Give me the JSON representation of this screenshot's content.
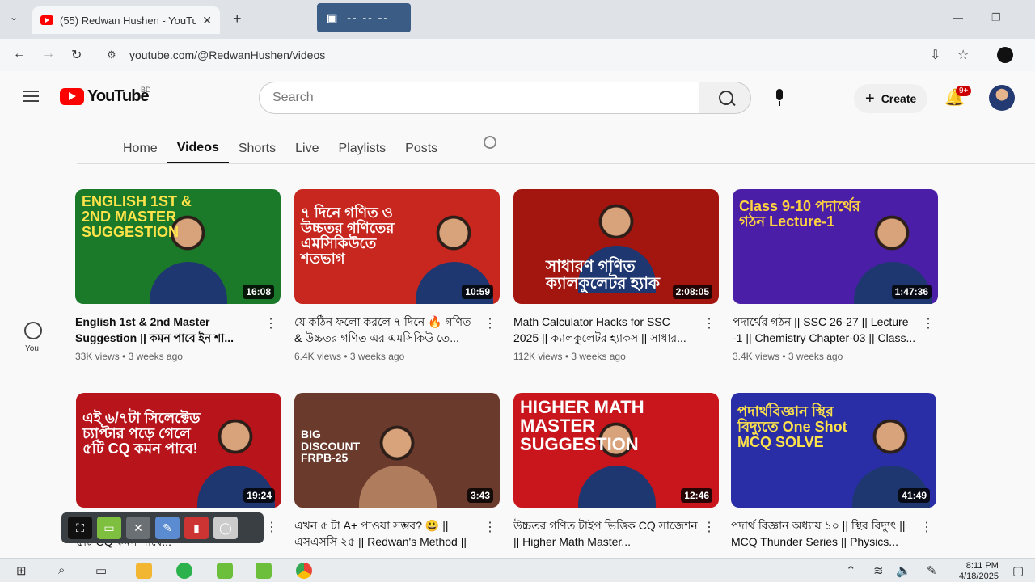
{
  "browser": {
    "tab_title": "(55) Redwan Hushen - YouTube",
    "tab_close": "✕",
    "new_tab": "+",
    "tablist": "⌄",
    "recorder_label": "-- -- --",
    "url": "youtube.com/@RedwanHushen/videos",
    "window_controls": {
      "minimize": "—",
      "restore": "❐"
    }
  },
  "header": {
    "logo_text": "YouTube",
    "country_code": "BD",
    "search_placeholder": "Search",
    "create_label": "Create",
    "notification_badge": "9+"
  },
  "channel_tabs": [
    {
      "label": "Home"
    },
    {
      "label": "Videos",
      "active": true
    },
    {
      "label": "Shorts"
    },
    {
      "label": "Live"
    },
    {
      "label": "Playlists"
    },
    {
      "label": "Posts"
    }
  ],
  "sidebar": {
    "you_label": "You"
  },
  "videos": [
    {
      "title": "English 1st & 2nd Master Suggestion || কমন পাবে ইন শা...",
      "views": "33K views",
      "age": "3 weeks ago",
      "duration": "16:08",
      "thumb_text": "ENGLISH 1ST & 2ND MASTER SUGGESTION",
      "bg": "#1b7a2a"
    },
    {
      "title": "যে কঠিন ফলো করলে ৭ দিনে 🔥 গণিত & উচ্চতর গণিত এর এমসিকিউ তে...",
      "views": "6.4K views",
      "age": "3 weeks ago",
      "duration": "10:59",
      "thumb_text": "৭ দিনে গণিত ও উচ্চতর গণিতের এমসিকিউতে শতভাগ",
      "bg": "#c7271f"
    },
    {
      "title": "Math Calculator Hacks for SSC 2025 || ক্যালকুলেটর হ্যাকস || সাধার...",
      "views": "112K views",
      "age": "3 weeks ago",
      "duration": "2:08:05",
      "thumb_text": "সাধারণ গণিত ক্যালকুলেটর হ্যাক",
      "bg": "#a3150f"
    },
    {
      "title": "পদার্থের গঠন || SSC 26-27 || Lecture -1 || Chemistry Chapter-03 || Class...",
      "views": "3.4K views",
      "age": "3 weeks ago",
      "duration": "1:47:36",
      "thumb_text": "Class 9-10 পদার্থের গঠন Lecture-1",
      "bg": "#4b1ea8"
    },
    {
      "title": "এই ৬/৭টা সিলেক্টেড চ্যাপ্টার পড়ে গেলে ৫টি CQ কমন পাবে...",
      "views": "",
      "age": "",
      "duration": "19:24",
      "thumb_text": "এই ৬/৭টা সিলেক্টেড চ্যাপ্টার পড়ে গেলে ৫টি CQ কমন পাবে!",
      "bg": "#b8141b"
    },
    {
      "title": "এখন ৫ টা A+ পাওয়া সম্ভব? 😃 || এসএসসি ২৫ || Redwan's Method ||",
      "views": "",
      "age": "",
      "duration": "3:43",
      "thumb_text": "BIG DISCOUNT FRPB-25",
      "bg": "#6a3a2c"
    },
    {
      "title": "উচ্চতর গণিত টাইপ ভিত্তিক CQ সাজেশন || Higher Math Master...",
      "views": "",
      "age": "",
      "duration": "12:46",
      "thumb_text": "HIGHER MATH MASTER SUGGESTION",
      "bg": "#c8161c"
    },
    {
      "title": "পদার্থ বিজ্ঞান অধ্যায় ১০ || স্থির বিদ্যুৎ || MCQ Thunder Series || Physics...",
      "views": "",
      "age": "",
      "duration": "41:49",
      "thumb_text": "পদার্থবিজ্ঞান স্থির বিদ্যুতে One Shot MCQ SOLVE",
      "bg": "#2a2ea6"
    }
  ],
  "taskbar": {
    "time": "8:11 PM",
    "date": "4/18/2025"
  },
  "colors": {
    "accent": "#ff0000",
    "page_bg": "#f9f9f9"
  }
}
